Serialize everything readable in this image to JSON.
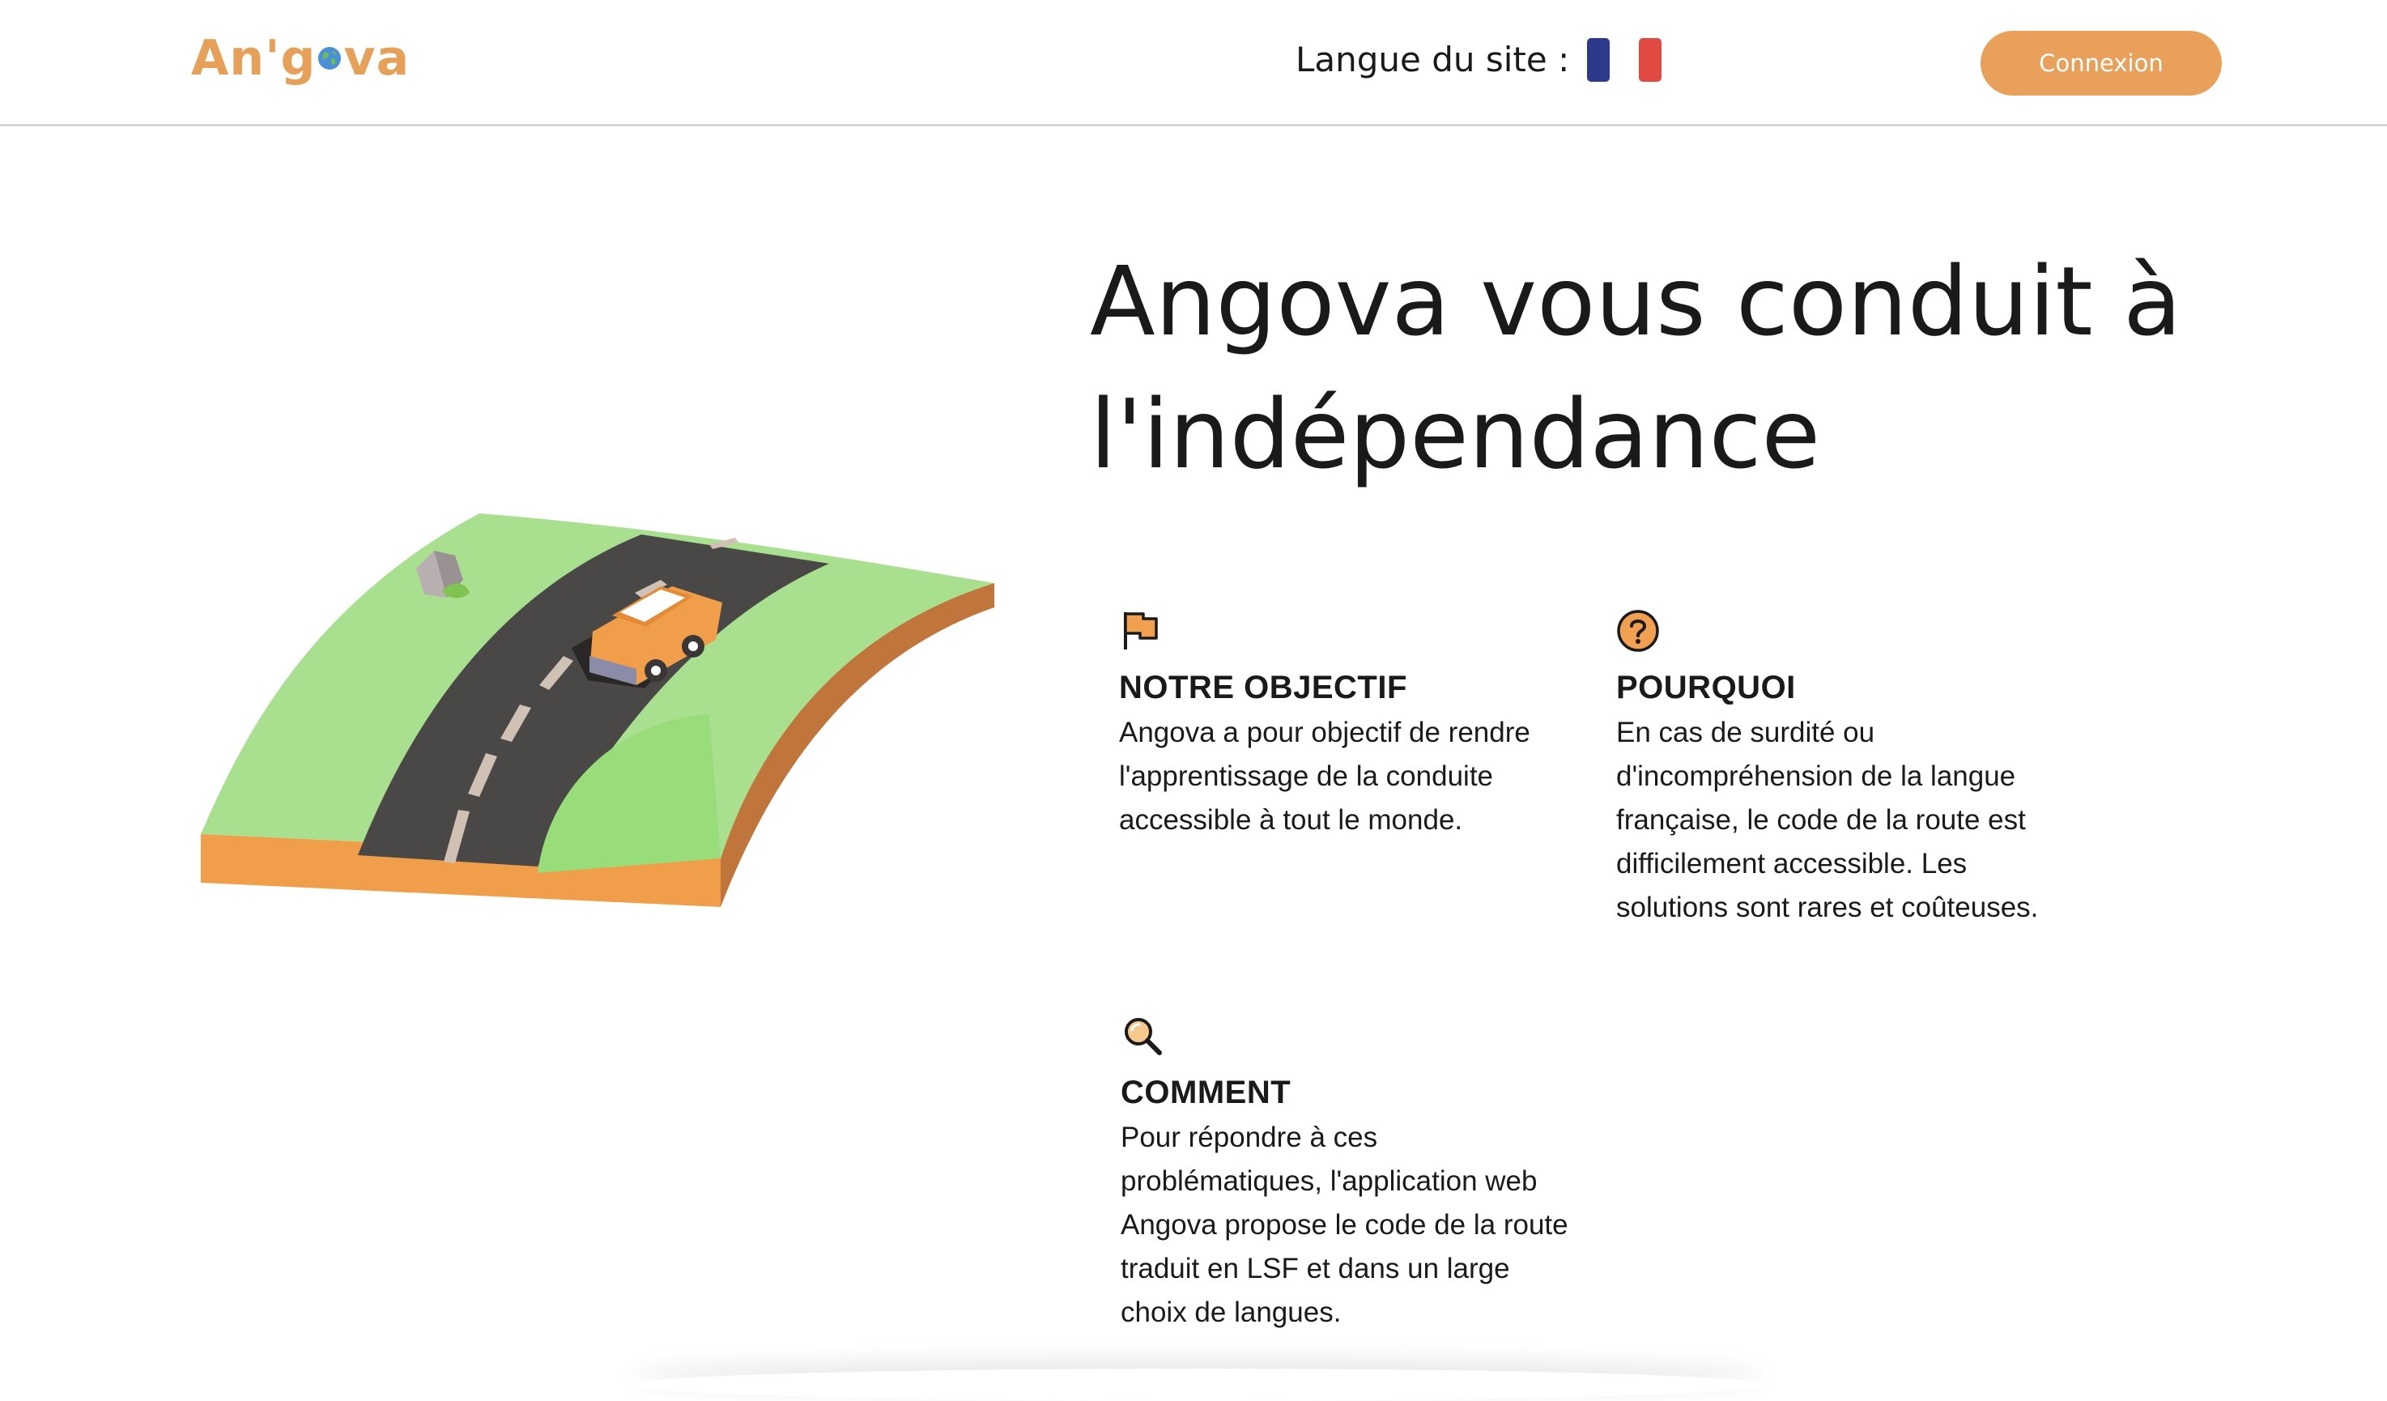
{
  "header": {
    "logo_text_before": "An'g",
    "logo_text_after": "va",
    "language_label": "Langue du site :",
    "language_flag": "french-flag",
    "login_label": "Connexion"
  },
  "hero": {
    "title": "Angova vous conduit à l'indépendance",
    "illustration": "car-on-road-illustration"
  },
  "features": [
    {
      "icon": "flag-icon",
      "title": "NOTRE OBJECTIF",
      "text": "Angova a pour objectif de rendre l'apprentissage de la conduite accessible à tout le monde."
    },
    {
      "icon": "question-icon",
      "title": "POURQUOI",
      "text": "En cas de surdité ou d'incompréhension de la langue française, le code de la route est difficilement accessible. Les solutions sont rares et coûteuses."
    },
    {
      "icon": "magnifier-icon",
      "title": "COMMENT",
      "text": "Pour répondre à ces problématiques, l'application web Angova propose le code de la route traduit en LSF et dans un large choix de langues."
    }
  ],
  "colors": {
    "brand": "#e8a05a",
    "text": "#1a1a1a",
    "flag_blue": "#2d3a8c",
    "flag_red": "#e04a42"
  }
}
